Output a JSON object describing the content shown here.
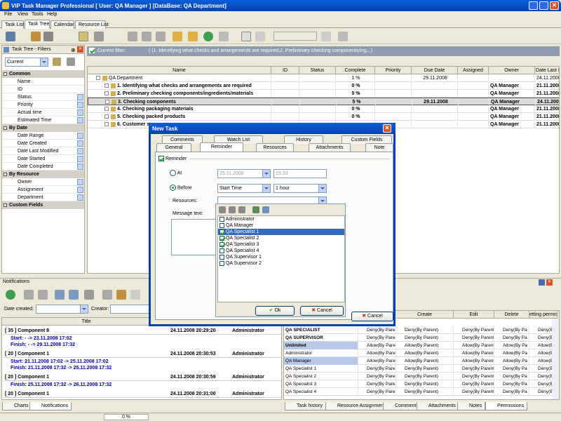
{
  "window": {
    "title": "VIP Task Manager Professional [ User: QA Manager ] [DataBase: QA Department]"
  },
  "menu": [
    "File",
    "View",
    "Tools",
    "Help"
  ],
  "main_tabs": [
    "Task List",
    "Task Tree",
    "Calendar",
    "Resource List"
  ],
  "filters": {
    "title": "Task Tree - Filters",
    "view_value": "Current",
    "current_filter_label": "Current filter:",
    "current_filter_text": "( (1. Identifying what checks and arrangements are required,2. Preliminary checking components/ing...)",
    "sections": [
      {
        "name": "Common",
        "items": [
          "Name",
          "ID",
          "Status",
          "Priority",
          "Actual time",
          "Estimated Time"
        ]
      },
      {
        "name": "By Date",
        "items": [
          "Date Range",
          "Date Created",
          "Date Last Modified",
          "Date Started",
          "Date Completed"
        ]
      },
      {
        "name": "By Resource",
        "items": [
          "Owner",
          "Assignment",
          "Department"
        ]
      },
      {
        "name": "Custom Fields",
        "items": []
      }
    ]
  },
  "task_grid": {
    "columns": [
      "Name",
      "ID",
      "Status",
      "Complete",
      "Priority",
      "Due Date",
      "Assigned",
      "Owner",
      "Date Last Modi..."
    ],
    "rows": [
      {
        "name": "QA Department",
        "complete": "1 %",
        "due": "29.11.2008",
        "assigned": "",
        "owner": "",
        "modified": "24.11.2008 20:5"
      },
      {
        "name": "1. Identifying what checks and arrangements are required",
        "complete": "0 %",
        "due": "",
        "assigned": "",
        "owner": "QA Manager",
        "modified": "21.11.2008 17:"
      },
      {
        "name": "2. Preliminary checking components/ingredients/materials",
        "complete": "0 %",
        "due": "",
        "assigned": "",
        "owner": "QA Manager",
        "modified": "21.11.2008 17:"
      },
      {
        "name": "3. Checking components",
        "complete": "5 %",
        "due": "29.11.2008",
        "assigned": "",
        "owner": "QA Manager",
        "modified": "24.11.2008 20:3"
      },
      {
        "name": "4. Checking packaging materials",
        "complete": "0 %",
        "due": "",
        "assigned": "",
        "owner": "QA Manager",
        "modified": "21.11.2008 17:"
      },
      {
        "name": "5. Checking packed products",
        "complete": "0 %",
        "due": "",
        "assigned": "",
        "owner": "QA Manager",
        "modified": "21.11.2008 17:"
      },
      {
        "name": "6. Customer su",
        "complete": "",
        "due": "",
        "assigned": "",
        "owner": "QA Manager",
        "modified": "21.11.2008 17:"
      }
    ]
  },
  "notifications": {
    "title": "Notifications",
    "date_created_label": "Date created:",
    "creator_label": "Creator:",
    "title_col": "Title",
    "items": [
      {
        "title": "[ 35 ] Component 8",
        "date": "24.11.2008 20:29:20",
        "user": "Administrator",
        "lines": [
          "Start:  - -> 23.11.2008 17:02",
          "Finish:  - -> 29.11.2008 17:32"
        ]
      },
      {
        "title": "[ 20 ] Component 1",
        "date": "24.11.2008 20:30:53",
        "user": "Administrator",
        "lines": [
          "Start: 21.11.2008 17:02 -> 25.11.2008 17:02",
          "Finish: 21.11.2008 17:32 -> 25.11.2008 17:32"
        ]
      },
      {
        "title": "[ 20 ] Component 1",
        "date": "24.11.2008 20:30:59",
        "user": "Administrator",
        "lines": [
          "Finish: 25.11.2008 17:32 -> 26.11.2008 17:32"
        ]
      },
      {
        "title": "[ 20 ] Component 1",
        "date": "24.11.2008 20:31:00",
        "user": "Administrator",
        "lines": [
          "Finish: 26.11.2008 17:32 -> 29.11.2008 0:00"
        ]
      }
    ]
  },
  "bottom_left_tabs": [
    "Charts",
    "Notifications"
  ],
  "permissions": {
    "columns": [
      "Create",
      "Edit",
      "Delete",
      "etting permissio"
    ],
    "rows": [
      {
        "name": "QA SPECIALIST",
        "v": [
          "Deny(By Parent)",
          "Deny(By Parent)",
          "Deny(By Pa",
          "Deny(By Pa"
        ],
        "first": "Deny(By Pare"
      },
      {
        "name": "QA SUPERVISOR",
        "v": [
          "Deny(By Parent)",
          "Deny(By Parent)",
          "Deny(By Pa",
          "Deny(By Pa"
        ],
        "first": "Deny(By Pare"
      },
      {
        "name": "Unlimited",
        "v": [
          "Allow(By Parent)",
          "Allow(By Parent)",
          "Allow(By Pa",
          "Allow(By Pa"
        ],
        "first": "Allow(By Parer"
      },
      {
        "name": "Administrator",
        "v": [
          "Allow(By Parent)",
          "Allow(By Parent)",
          "Allow(By Pa",
          "Allow(By Pa"
        ],
        "first": "Allow(By Parer"
      },
      {
        "name": "QA Manager",
        "v": [
          "Allow(By Parent)",
          "Allow(By Parent)",
          "Allow(By Pa",
          "Allow(By Pa"
        ],
        "first": "Allow(By Parer"
      },
      {
        "name": "QA Specialist 1",
        "v": [
          "Deny(By Parent)",
          "Deny(By Parent)",
          "Deny(By Pa",
          "Deny(By Pa"
        ],
        "first": "Deny(By Pare"
      },
      {
        "name": "QA Specialist 2",
        "v": [
          "Deny(By Parent)",
          "Deny(By Parent)",
          "Deny(By Pa",
          "Deny(By Pa"
        ],
        "first": "Deny(By Pare"
      },
      {
        "name": "QA Specialist 3",
        "v": [
          "Deny(By Parent)",
          "Deny(By Parent)",
          "Deny(By Pa",
          "Deny(By Pa"
        ],
        "first": "Deny(By Pare"
      },
      {
        "name": "QA Specialist 4",
        "v": [
          "Deny(By Parent)",
          "Deny(By Parent)",
          "Deny(By Pa",
          "Deny(By Pa"
        ],
        "first": "Deny(By Pare"
      }
    ]
  },
  "bottom_right_tabs": [
    "Task history",
    "Resource Assignment",
    "Comments",
    "Attachments",
    "Notes",
    "Permissions"
  ],
  "status_bar": {
    "progress": "0 %"
  },
  "dialog": {
    "title": "New Task",
    "tabs_row1": [
      "Comments",
      "Watch List",
      "History",
      "Custom Fields"
    ],
    "tabs_row2": [
      "General",
      "Reminder",
      "Resources",
      "Attachments",
      "Note"
    ],
    "reminder_label": "Reminder",
    "at_label": "At",
    "at_date": "25.11.2008",
    "at_time": "15:33",
    "before_label": "Before",
    "before_value": "Start Time",
    "before_amount": "1 hour",
    "resources_label": "Resources:",
    "message_label": "Message text:",
    "resource_list": [
      {
        "name": "Administrator",
        "checked": false
      },
      {
        "name": "QA Manager",
        "checked": false
      },
      {
        "name": "QA Specialist 1",
        "checked": true
      },
      {
        "name": "QA Specialist 2",
        "checked": true
      },
      {
        "name": "QA Specialist 3",
        "checked": true
      },
      {
        "name": "QA Specialist 4",
        "checked": false
      },
      {
        "name": "QA Supervisor 1",
        "checked": false
      },
      {
        "name": "QA Supervisor 2",
        "checked": false
      }
    ],
    "ok": "Ok",
    "cancel": "Cancel",
    "dialog_cancel": "Cancel"
  }
}
